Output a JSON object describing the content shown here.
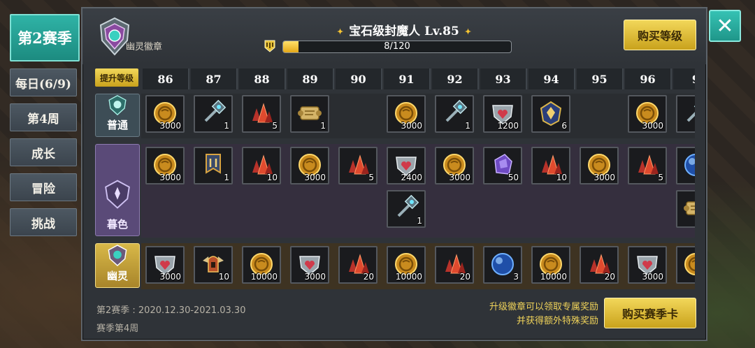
{
  "tabs": {
    "season": "第2赛季",
    "items": [
      "每日(6/9)",
      "第4周",
      "成长",
      "冒险",
      "挑战"
    ]
  },
  "header": {
    "badge_label": "幽灵徽章",
    "title": "宝石级封魔人  Lv.85",
    "progress_text": "8/120",
    "progress_fraction": 0.067,
    "buy_level": "购买等级"
  },
  "grid": {
    "upgrade_tag": "提升等级",
    "levels": [
      "86",
      "87",
      "88",
      "89",
      "90",
      "91",
      "92",
      "93",
      "94",
      "95",
      "96",
      "9"
    ],
    "rows": {
      "normal": "普通",
      "dusk": "暮色",
      "ghost": "幽灵"
    },
    "normal_items": [
      {
        "icon": "coin-icon",
        "qty": "3000"
      },
      {
        "icon": "hammer-icon",
        "qty": "1"
      },
      {
        "icon": "crystal-icon",
        "qty": "5"
      },
      {
        "icon": "scroll-icon",
        "qty": "1"
      },
      null,
      {
        "icon": "coin-icon",
        "qty": "3000"
      },
      {
        "icon": "hammer-icon",
        "qty": "1"
      },
      {
        "icon": "shield-heart-icon",
        "qty": "1200"
      },
      {
        "icon": "mystery-gem-icon",
        "qty": "6"
      },
      null,
      {
        "icon": "coin-icon",
        "qty": "3000"
      },
      {
        "icon": "hammer-icon",
        "qty": ""
      }
    ],
    "dusk_items": [
      {
        "icon": "coin-icon",
        "qty": "3000"
      },
      {
        "icon": "banner-icon",
        "qty": "1"
      },
      {
        "icon": "crystal-icon",
        "qty": "10"
      },
      {
        "icon": "coin-icon",
        "qty": "3000"
      },
      {
        "icon": "crystal-icon",
        "qty": "5"
      },
      {
        "icon": "shield-heart-icon",
        "qty": "2400"
      },
      {
        "icon": "coin-icon",
        "qty": "3000"
      },
      {
        "icon": "purple-gem-icon",
        "qty": "50"
      },
      {
        "icon": "crystal-icon",
        "qty": "10"
      },
      {
        "icon": "coin-icon",
        "qty": "3000"
      },
      {
        "icon": "crystal-icon",
        "qty": "5"
      },
      {
        "icon": "blue-orb-icon",
        "qty": ""
      }
    ],
    "dusk_extra": [
      {
        "col": 5,
        "icon": "hammer-icon",
        "qty": "1"
      },
      {
        "col": 11,
        "icon": "scroll-icon",
        "qty": ""
      }
    ],
    "ghost_items": [
      {
        "icon": "shield-heart-icon",
        "qty": "3000"
      },
      {
        "icon": "winged-helm-icon",
        "qty": "10"
      },
      {
        "icon": "coin-icon",
        "qty": "10000"
      },
      {
        "icon": "shield-heart-icon",
        "qty": "3000"
      },
      {
        "icon": "crystal-icon",
        "qty": "20"
      },
      {
        "icon": "coin-icon",
        "qty": "10000"
      },
      {
        "icon": "crystal-icon",
        "qty": "20"
      },
      {
        "icon": "blue-orb-icon",
        "qty": "3"
      },
      {
        "icon": "coin-icon",
        "qty": "10000"
      },
      {
        "icon": "crystal-icon",
        "qty": "20"
      },
      {
        "icon": "shield-heart-icon",
        "qty": "3000"
      },
      {
        "icon": "coin-icon",
        "qty": ""
      }
    ]
  },
  "footer": {
    "season_dates": "第2赛季 : 2020.12.30-2021.03.30",
    "season_week": "赛季第4周",
    "note_line1": "升级徽章可以领取专属奖励",
    "note_line2": "并获得额外特殊奖励",
    "buy_card": "购买赛季卡"
  },
  "colors": {
    "accent_teal": "#2fb3a6",
    "gold": "#e0b938",
    "dusk_purple": "#5a4a78"
  }
}
